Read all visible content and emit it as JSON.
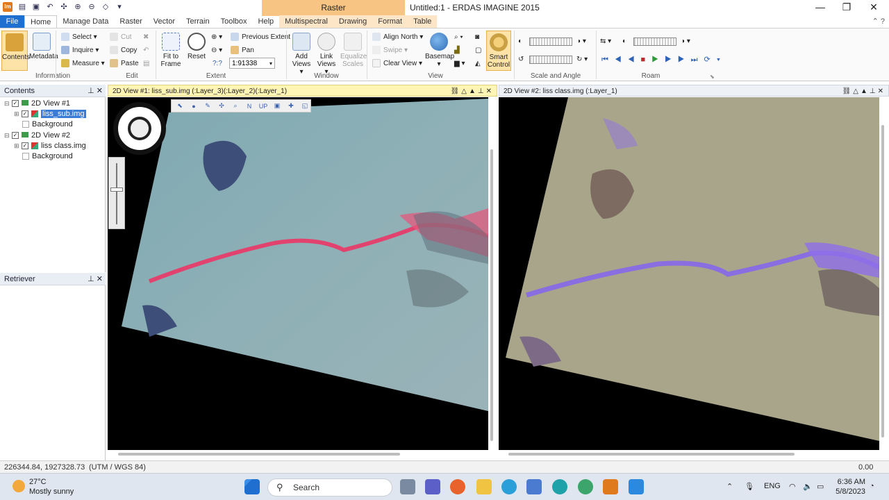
{
  "titlebar": {
    "context_tab_title": "Raster",
    "window_title": "Untitled:1 - ERDAS IMAGINE 2015",
    "minimize": "—",
    "maximize": "❐",
    "close": "✕"
  },
  "tabs": [
    "File",
    "Home",
    "Manage Data",
    "Raster",
    "Vector",
    "Terrain",
    "Toolbox",
    "Help",
    "Multispectral",
    "Drawing",
    "Format",
    "Table"
  ],
  "ribbon": {
    "information": {
      "label": "Information",
      "contents": "Contents",
      "metadata": "Metadata"
    },
    "edit": {
      "label": "Edit",
      "select": "Select",
      "inquire": "Inquire",
      "measure": "Measure",
      "cut": "Cut",
      "copy": "Copy",
      "paste": "Paste"
    },
    "extent": {
      "label": "Extent",
      "fit_to_frame": "Fit to Frame",
      "reset": "Reset",
      "previous_extent": "Previous Extent",
      "pan": "Pan",
      "scale_value": "1:91338",
      "scale_hint": "?:?"
    },
    "window": {
      "label": "Window",
      "add_views": "Add Views",
      "link_views": "Link Views",
      "equalize_scales": "Equalize Scales"
    },
    "view": {
      "label": "View",
      "align_north": "Align North",
      "swipe": "Swipe",
      "clear_view": "Clear View",
      "basemap": "Basemap",
      "smart_control": "Smart Control"
    },
    "scale_angle": {
      "label": "Scale and Angle"
    },
    "roam": {
      "label": "Roam"
    }
  },
  "contents_panel": {
    "title": "Contents",
    "items": [
      {
        "label": "2D View #1"
      },
      {
        "label": "liss_sub.img"
      },
      {
        "label": "Background"
      },
      {
        "label": "2D View #2"
      },
      {
        "label": "liss class.img"
      },
      {
        "label": "Background"
      }
    ]
  },
  "retriever_panel": {
    "title": "Retriever"
  },
  "views": {
    "view1_title": "2D View #1: liss_sub.img (:Layer_3)(:Layer_2)(:Layer_1)",
    "view2_title": "2D View #2: liss class.img (:Layer_1)",
    "view_tools": [
      "⬉",
      "●",
      "✎",
      "✣",
      "⌕",
      "N",
      "UP",
      "▣",
      "✚",
      "◱"
    ]
  },
  "statusbar": {
    "coordinates": "226344.84, 1927328.73",
    "projection": "(UTM / WGS 84)",
    "value": "0.00"
  },
  "taskbar": {
    "temperature": "27°C",
    "weather": "Mostly sunny",
    "search_placeholder": "Search",
    "language": "ENG",
    "time": "6:36 AM",
    "date": "5/8/2023"
  }
}
